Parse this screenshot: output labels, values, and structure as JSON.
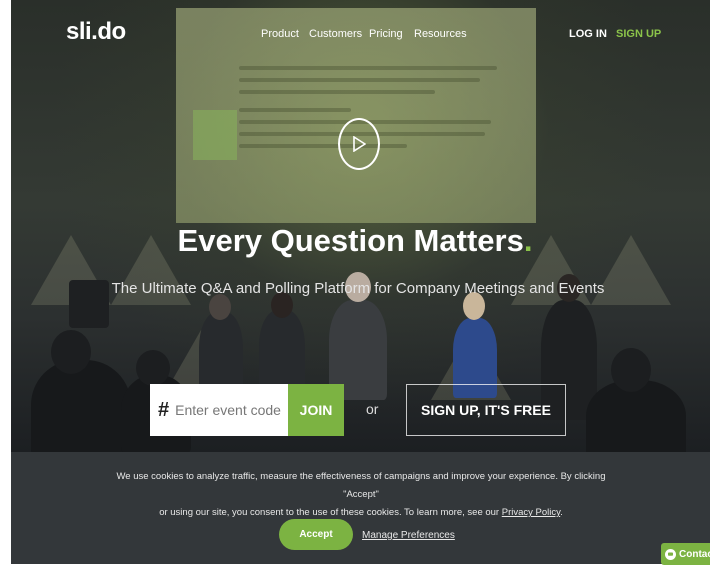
{
  "brand": {
    "logo_text": "sli.do",
    "accent": "#7cb342",
    "accent_light": "#8bc34a"
  },
  "nav": {
    "links": [
      "Product",
      "Customers",
      "Pricing",
      "Resources"
    ],
    "login_label": "LOG IN",
    "signup_label": "SIGN UP"
  },
  "hero": {
    "headline": "Every Question Matters",
    "headline_dot": ".",
    "subheadline": "The Ultimate Q&A and Polling Platform for Company Meetings and Events",
    "play_icon": "play-icon"
  },
  "join": {
    "hash_symbol": "#",
    "placeholder": "Enter event code",
    "join_label": "JOIN",
    "or_label": "or",
    "signup_free_label": "SIGN UP, IT'S FREE"
  },
  "cookie": {
    "line1": "We use cookies to analyze traffic, measure the effectiveness of campaigns and improve your experience. By clicking \"Accept\"",
    "line2": "or using our site, you consent to the use of these cookies. To learn more, see our ",
    "privacy_link": "Privacy Policy",
    "line2_end": ".",
    "accept_label": "Accept",
    "manage_label": "Manage Preferences"
  },
  "contact": {
    "label": "Contact",
    "icon": "chat-icon"
  }
}
